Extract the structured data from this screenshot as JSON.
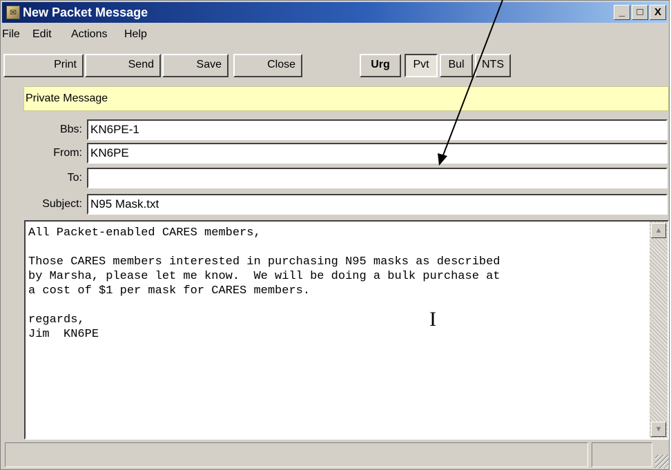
{
  "window": {
    "title": "New Packet Message",
    "controls": [
      "_",
      "□",
      "X"
    ]
  },
  "menubar": {
    "items": [
      "File",
      "Edit",
      "Actions",
      "Help"
    ]
  },
  "toolbar": {
    "print": "Print",
    "send": "Send",
    "save": "Save",
    "close": "Close",
    "urg": "Urg",
    "pvt": "Pvt",
    "bul": "Bul",
    "nts": "NTS"
  },
  "banner": "Private Message",
  "fields": {
    "bbs": {
      "label": "Bbs:",
      "value": "KN6PE-1"
    },
    "from": {
      "label": "From:",
      "value": "KN6PE"
    },
    "to": {
      "label": "To:",
      "value": ""
    },
    "subject": {
      "label": "Subject:",
      "value": "N95 Mask.txt"
    }
  },
  "body": "All Packet-enabled CARES members,\n\nThose CARES members interested in purchasing N95 masks as described\nby Marsha, please let me know.  We will be doing a bulk purchase at\na cost of $1 per mask for CARES members.\n\nregards,\nJim  KN6PE",
  "icons": {
    "scroll_up": "▲",
    "scroll_down": "▼",
    "text_cursor": "I"
  },
  "colors": {
    "titlebar_start": "#0a246a",
    "titlebar_end": "#a6caf0",
    "window_face": "#d4d0c8",
    "banner_bg": "#ffffc0"
  }
}
